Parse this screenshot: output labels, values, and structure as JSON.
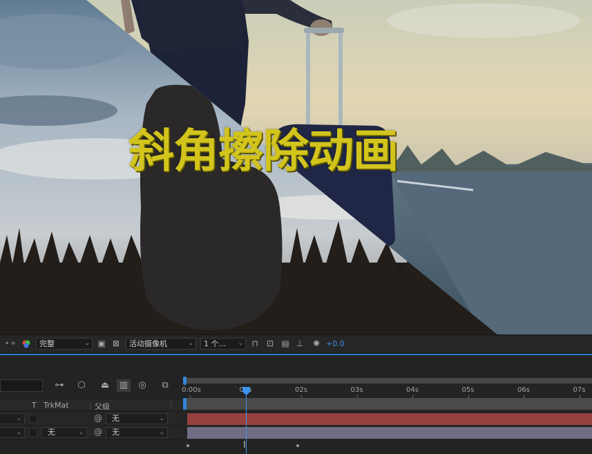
{
  "composition": {
    "overlay_text": "斜角擦除动画"
  },
  "viewer_toolbar": {
    "resolution": "完整",
    "camera": "活动摄像机",
    "views": "1 个...",
    "exposure": "+0.0",
    "icons": [
      "snapshot-icon",
      "color-channel-icon",
      "transparency-grid-icon",
      "mask-icon",
      "region-of-interest-icon",
      "3d-icon",
      "reset-exposure-icon",
      "flowchart-icon",
      "fast-preview-icon"
    ]
  },
  "timeline": {
    "columns": {
      "t": "T",
      "trkmat": "TrkMat",
      "parent": "父级"
    },
    "layers": [
      {
        "trkmat": "",
        "parent": "无",
        "bar_color": "#964040"
      },
      {
        "trkmat": "无",
        "parent": "无",
        "bar_color": "#6f6c84"
      }
    ],
    "ruler_labels": [
      "0:00s",
      "01s",
      "02s",
      "03s",
      "04s",
      "05s",
      "06s",
      "07s"
    ],
    "current_time_seconds": 1.0,
    "playhead_color": "#3a95f0",
    "accent_color": "#2b79c9"
  }
}
